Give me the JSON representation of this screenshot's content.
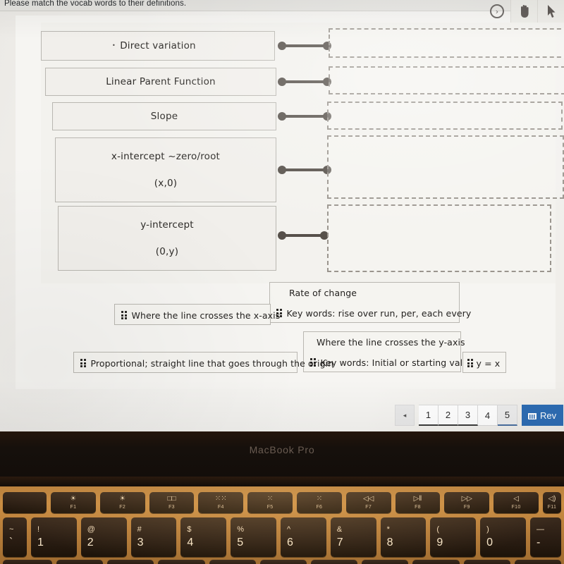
{
  "instruction": "Please match the vocab words to their definitions.",
  "tools": [
    {
      "name": "next-arrow-icon",
      "glyph": "›"
    },
    {
      "name": "hand-tool-icon",
      "glyph": "✋"
    }
  ],
  "terms": [
    {
      "pre": "•",
      "label": "Direct variation",
      "sub": ""
    },
    {
      "pre": "",
      "label": "Linear Parent Function",
      "sub": ""
    },
    {
      "pre": "",
      "label": "Slope",
      "sub": ""
    },
    {
      "pre": "",
      "label": "x-intercept ~zero/root",
      "sub": "(x,0)"
    },
    {
      "pre": "",
      "label": "y-intercept",
      "sub": "(0,y)"
    }
  ],
  "dropzones": [
    {
      "label": ""
    },
    {
      "label": ""
    },
    {
      "label": ""
    },
    {
      "label": ""
    },
    {
      "label": ""
    }
  ],
  "answer_bank": [
    {
      "top": "",
      "text": "Where the line crosses the x-axis"
    },
    {
      "top": "Rate of change",
      "text": "Key words: rise over run, per, each every"
    },
    {
      "top": "",
      "text": "Proportional; straight line that goes through the origin"
    },
    {
      "top": "Where the line crosses the y-axis",
      "text": "Key words: Initial or starting value"
    },
    {
      "top": "",
      "text": "y = x"
    }
  ],
  "pagination": {
    "prev": "◂",
    "pages": [
      "1",
      "2",
      "3",
      "4",
      "5"
    ],
    "current": "5",
    "review_label": "Rev"
  },
  "laptop": {
    "brand": "MacBook Pro"
  },
  "keyboard": {
    "function_row": [
      {
        "glyph": "",
        "label": ""
      },
      {
        "glyph": "☀",
        "label": "F1"
      },
      {
        "glyph": "☀",
        "label": "F2"
      },
      {
        "glyph": "□□",
        "label": "F3"
      },
      {
        "glyph": "⁙⁙",
        "label": "F4"
      },
      {
        "glyph": "⁙",
        "label": "F5"
      },
      {
        "glyph": "⁙",
        "label": "F6"
      },
      {
        "glyph": "◁◁",
        "label": "F7"
      },
      {
        "glyph": "▷‖",
        "label": "F8"
      },
      {
        "glyph": "▷▷",
        "label": "F9"
      },
      {
        "glyph": "◁",
        "label": "F10"
      },
      {
        "glyph": "◁)",
        "label": "F11"
      },
      {
        "glyph": "",
        "label": ""
      }
    ],
    "number_row": [
      {
        "shifted": "~",
        "base": "`"
      },
      {
        "shifted": "!",
        "base": "1"
      },
      {
        "shifted": "@",
        "base": "2"
      },
      {
        "shifted": "#",
        "base": "3"
      },
      {
        "shifted": "$",
        "base": "4"
      },
      {
        "shifted": "%",
        "base": "5"
      },
      {
        "shifted": "^",
        "base": "6"
      },
      {
        "shifted": "&",
        "base": "7"
      },
      {
        "shifted": "*",
        "base": "8"
      },
      {
        "shifted": "(",
        "base": "9"
      },
      {
        "shifted": ")",
        "base": "0"
      },
      {
        "shifted": "—",
        "base": "-"
      }
    ]
  },
  "colors": {
    "accent_blue": "#2d6cb3",
    "connector": "#56504a",
    "tile_border": "#b9b7b1",
    "panel_bg": "#f3f2ee"
  }
}
